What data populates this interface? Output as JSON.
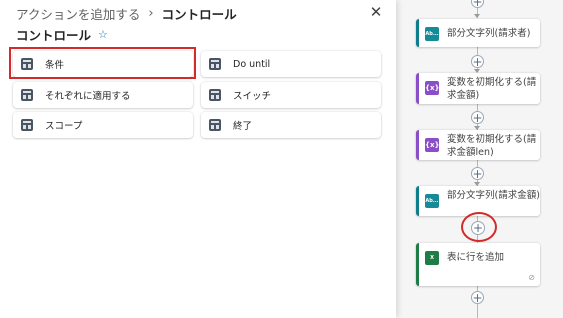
{
  "panel": {
    "breadcrumb": [
      "アクションを追加する",
      "コントロール"
    ],
    "breadcrumb_separator": "›",
    "title": "コントロール",
    "favorite_icon": "star-icon",
    "close_icon": "close-icon",
    "actions": [
      {
        "label": "条件",
        "icon": "control-icon",
        "highlighted": true
      },
      {
        "label": "Do until",
        "icon": "control-icon"
      },
      {
        "label": "それぞれに適用する",
        "icon": "control-icon"
      },
      {
        "label": "スイッチ",
        "icon": "control-icon"
      },
      {
        "label": "スコープ",
        "icon": "control-icon"
      },
      {
        "label": "終了",
        "icon": "control-icon"
      }
    ],
    "highlight_color": "#d42a2a"
  },
  "flow": {
    "steps": [
      {
        "label": "部分文字列(請求者)",
        "icon_text": "Ab...",
        "kind": "text-function",
        "accent": "#0e7e8c"
      },
      {
        "label": "変数を初期化する(請求金額)",
        "icon_text": "{x}",
        "kind": "variable",
        "accent": "#8a4ec7"
      },
      {
        "label": "変数を初期化する(請求金額len)",
        "icon_text": "{x}",
        "kind": "variable",
        "accent": "#8a4ec7"
      },
      {
        "label": "部分文字列(請求金額)",
        "icon_text": "Ab...",
        "kind": "text-function",
        "accent": "#0e7e8c"
      },
      {
        "label": "表に行を追加",
        "icon_text": "X",
        "kind": "excel",
        "accent": "#1f7c47"
      }
    ],
    "add_step_symbol": "+",
    "circled_insert_point": "between step 4 and step 5"
  }
}
